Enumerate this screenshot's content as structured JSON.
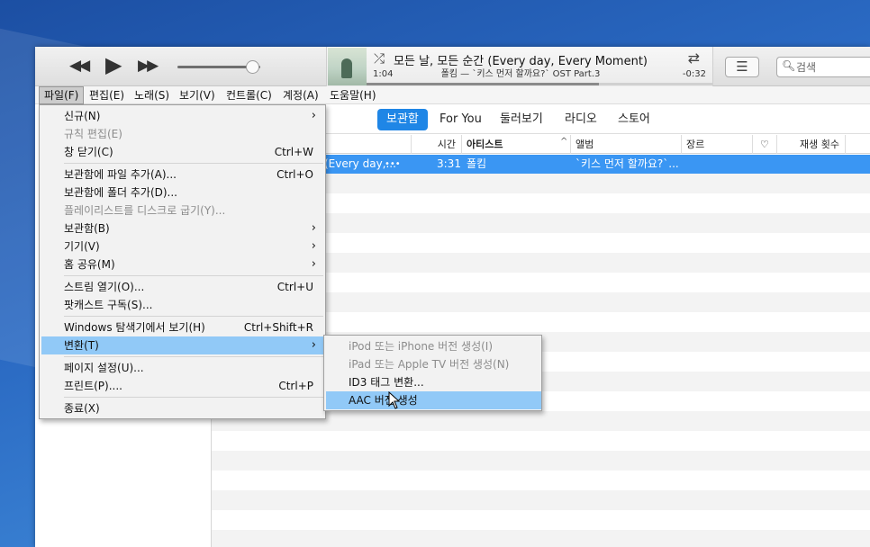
{
  "toolbar": {
    "rewind_icon": "rewind-icon",
    "play_icon": "play-icon",
    "forward_icon": "fast-forward-icon",
    "volume_level": 0.9
  },
  "now_playing": {
    "title": "모든 날, 모든 순간 (Every day, Every Moment)",
    "subtitle": "폴킴 — `키스 먼저 할까요?` OST Part.3",
    "elapsed": "1:04",
    "remaining": "-0:32",
    "progress": 0.67
  },
  "search": {
    "placeholder": "검색"
  },
  "menubar": [
    {
      "label": "파일(F)"
    },
    {
      "label": "편집(E)"
    },
    {
      "label": "노래(S)"
    },
    {
      "label": "보기(V)"
    },
    {
      "label": "컨트롤(C)"
    },
    {
      "label": "계정(A)"
    },
    {
      "label": "도움말(H)"
    }
  ],
  "tabs": [
    {
      "label": "보관함"
    },
    {
      "label": "For You"
    },
    {
      "label": "둘러보기"
    },
    {
      "label": "라디오"
    },
    {
      "label": "스토어"
    }
  ],
  "columns": {
    "time": "시간",
    "artist": "아티스트",
    "album": "앨범",
    "genre": "장르",
    "love": "♡",
    "plays": "재생 횟수"
  },
  "track": {
    "name": "(Every day,...",
    "more": "•••",
    "time": "3:31",
    "artist": "폴킴",
    "album": "`키스 먼저 할까요?`..."
  },
  "file_menu": {
    "items": [
      {
        "label": "신규(N)",
        "shortcut": "",
        "arrow": "›"
      },
      {
        "label": "규칙 편집(E)",
        "shortcut": "",
        "arrow": ""
      },
      {
        "label": "창 닫기(C)",
        "shortcut": "Ctrl+W",
        "arrow": ""
      },
      {
        "label": "보관함에 파일 추가(A)...",
        "shortcut": "Ctrl+O",
        "arrow": ""
      },
      {
        "label": "보관함에 폴더 추가(D)...",
        "shortcut": "",
        "arrow": ""
      },
      {
        "label": "플레이리스트를 디스크로 굽기(Y)...",
        "shortcut": "",
        "arrow": ""
      },
      {
        "label": "보관함(B)",
        "shortcut": "",
        "arrow": "›"
      },
      {
        "label": "기기(V)",
        "shortcut": "",
        "arrow": "›"
      },
      {
        "label": "홈 공유(M)",
        "shortcut": "",
        "arrow": "›"
      },
      {
        "label": "스트림 열기(O)...",
        "shortcut": "Ctrl+U",
        "arrow": ""
      },
      {
        "label": "팟캐스트 구독(S)...",
        "shortcut": "",
        "arrow": ""
      },
      {
        "label": "Windows 탐색기에서 보기(H)",
        "shortcut": "Ctrl+Shift+R",
        "arrow": ""
      },
      {
        "label": "변환(T)",
        "shortcut": "",
        "arrow": "›"
      },
      {
        "label": "페이지 설정(U)...",
        "shortcut": "",
        "arrow": ""
      },
      {
        "label": "프린트(P)....",
        "shortcut": "Ctrl+P",
        "arrow": ""
      },
      {
        "label": "종료(X)",
        "shortcut": "",
        "arrow": ""
      }
    ]
  },
  "convert_submenu": {
    "items": [
      {
        "label": "iPod 또는 iPhone 버전 생성(I)"
      },
      {
        "label": "iPad 또는 Apple TV 버전 생성(N)"
      },
      {
        "label": "ID3 태그 변환..."
      },
      {
        "label": "AAC 버전 생성"
      }
    ]
  },
  "colors": {
    "accent": "#1f86e6",
    "selected_row": "#3a96f3",
    "menu_highlight": "#91c9f7"
  }
}
